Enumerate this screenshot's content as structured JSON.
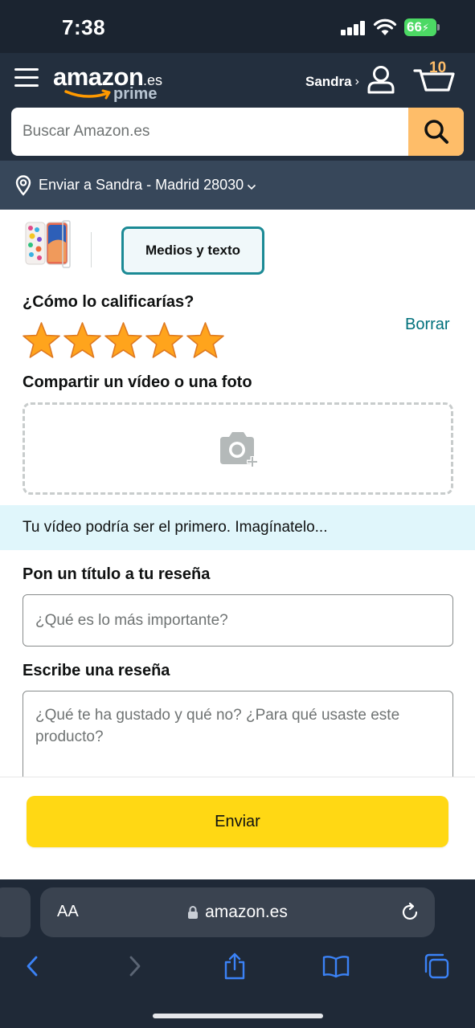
{
  "status_bar": {
    "time": "7:38",
    "battery": "66"
  },
  "header": {
    "logo_word": "amazon",
    "logo_tld": ".es",
    "logo_sub": "prime",
    "account_name": "Sandra",
    "account_chevron": "›",
    "cart_count": "10",
    "search_placeholder": "Buscar Amazon.es",
    "delivery_text": "Enviar a Sandra - Madrid 28030",
    "icons": [
      "menu-icon",
      "user-icon",
      "cart-icon",
      "search-icon",
      "location-pin-icon",
      "chevron-down-icon"
    ]
  },
  "review": {
    "tab_label": "Medios y texto",
    "rating_question": "¿Cómo lo calificarías?",
    "clear_label": "Borrar",
    "rating": 5,
    "rating_max": 5,
    "share_title": "Compartir un vídeo o una foto",
    "video_banner": "Tu vídeo podría ser el primero. Imagínatelo...",
    "title_label": "Pon un título a tu reseña",
    "title_placeholder": "¿Qué es lo más importante?",
    "review_label": "Escribe una reseña",
    "review_placeholder": "¿Qué te ha gustado y qué no? ¿Para qué usaste este producto?",
    "submit_label": "Enviar"
  },
  "safari": {
    "text_size_label": "AA",
    "url": "amazon.es",
    "icons": [
      "lock-icon",
      "reload-icon",
      "back-icon",
      "forward-icon",
      "share-icon",
      "bookmarks-icon",
      "tabs-icon"
    ]
  },
  "colors": {
    "header_bg": "#232f3e",
    "delivery_bg": "#37475a",
    "search_button": "#febd69",
    "accent_teal": "#1b8a95",
    "link_teal": "#00707b",
    "star": "#ffa41c",
    "submit_button": "#ffd814",
    "banner_bg": "#e0f6fb",
    "safari_blue": "#3b82f6"
  }
}
